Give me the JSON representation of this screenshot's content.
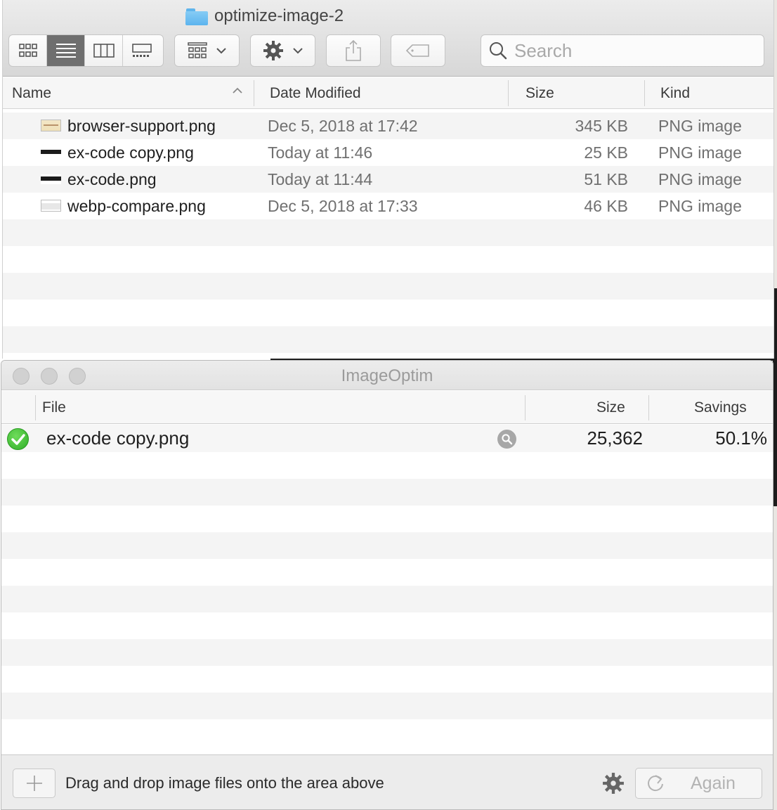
{
  "finder": {
    "folder_name": "optimize-image-2",
    "search": {
      "placeholder": "Search",
      "value": ""
    },
    "view_modes": [
      "icon-view",
      "list-view",
      "column-view",
      "gallery-view"
    ],
    "active_view": "list-view",
    "columns": {
      "name": "Name",
      "date": "Date Modified",
      "size": "Size",
      "kind": "Kind"
    },
    "sort": {
      "column": "Name",
      "direction": "ascending"
    },
    "files": [
      {
        "name": "browser-support.png",
        "date": "Dec 5, 2018 at 17:42",
        "size": "345 KB",
        "kind": "PNG image",
        "thumb": "thumb-browser"
      },
      {
        "name": "ex-code copy.png",
        "date": "Today at 11:46",
        "size": "25 KB",
        "kind": "PNG image",
        "thumb": "thumb-dark"
      },
      {
        "name": "ex-code.png",
        "date": "Today at 11:44",
        "size": "51 KB",
        "kind": "PNG image",
        "thumb": "thumb-dark"
      },
      {
        "name": "webp-compare.png",
        "date": "Dec 5, 2018 at 17:33",
        "size": "46 KB",
        "kind": "PNG image",
        "thumb": "thumb-light"
      }
    ]
  },
  "imageoptim": {
    "title": "ImageOptim",
    "columns": {
      "file": "File",
      "size": "Size",
      "savings": "Savings"
    },
    "rows": [
      {
        "file": "ex-code copy.png",
        "size": "25,362",
        "savings": "50.1%",
        "status": "done"
      }
    ],
    "footer": {
      "hint": "Drag and drop image files onto the area above",
      "again_label": "Again"
    }
  },
  "colors": {
    "success_green": "#2fae27",
    "folder_blue": "#5cb4ee",
    "active_segment": "#6f6f6f"
  }
}
